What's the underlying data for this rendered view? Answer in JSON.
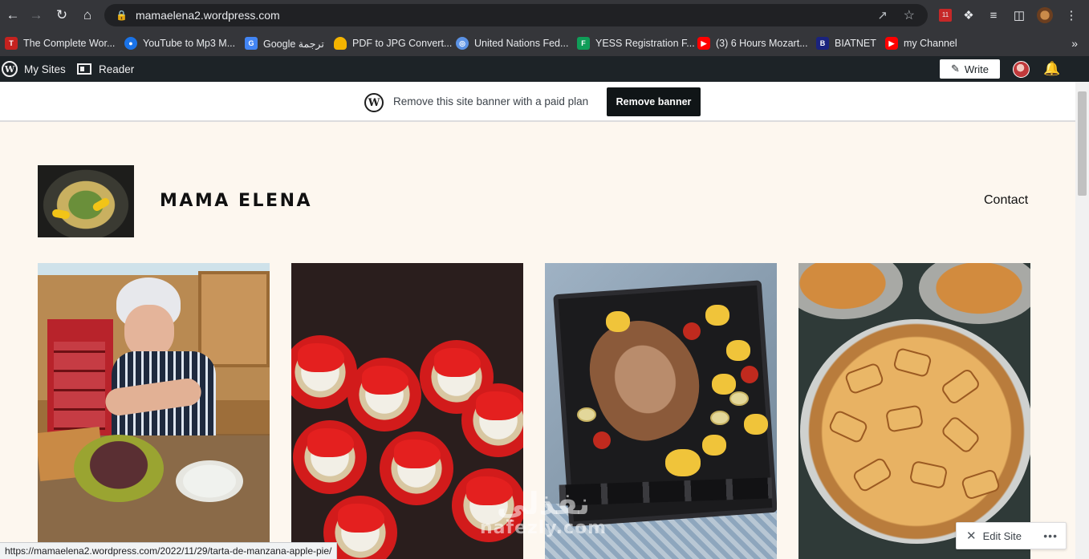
{
  "browser": {
    "url": "mamaelena2.wordpress.com",
    "bookmarks": [
      {
        "label": "The Complete Wor...",
        "icon": "red-square-icon",
        "color": "#c5221f"
      },
      {
        "label": "YouTube to Mp3 M...",
        "icon": "blue-disc-icon",
        "color": "#1a73e8"
      },
      {
        "label": "Google ترجمة",
        "icon": "google-translate-icon",
        "color": "#4285f4"
      },
      {
        "label": "PDF to JPG Convert...",
        "icon": "burger-icon",
        "color": "#f4b400"
      },
      {
        "label": "United Nations Fed...",
        "icon": "un-emblem-icon",
        "color": "#5b92e5"
      },
      {
        "label": "YESS Registration F...",
        "icon": "forms-icon",
        "color": "#0f9d58"
      },
      {
        "label": "(3) 6 Hours Mozart...",
        "icon": "youtube-icon",
        "color": "#ff0000"
      },
      {
        "label": "BIATNET",
        "icon": "biat-icon",
        "color": "#1a237e"
      },
      {
        "label": "my Channel",
        "icon": "youtube-icon",
        "color": "#ff0000"
      }
    ],
    "status_url": "https://mamaelena2.wordpress.com/2022/11/29/tarta-de-manzana-apple-pie/"
  },
  "wpbar": {
    "my_sites": "My Sites",
    "reader": "Reader",
    "write": "Write"
  },
  "banner": {
    "text": "Remove this site banner with a paid plan",
    "button": "Remove banner"
  },
  "site": {
    "title": "MAMA ELENA",
    "nav": [
      "Contact"
    ]
  },
  "watermark": {
    "arabic": "نفذلي",
    "latin": "nafezly.com"
  },
  "edit_site": {
    "label": "Edit Site",
    "more": "•••"
  },
  "colors": {
    "chrome_dark": "#35363a",
    "wp_bar": "#1d2327",
    "page_bg": "#fdf7ef",
    "banner_button": "#101517"
  }
}
